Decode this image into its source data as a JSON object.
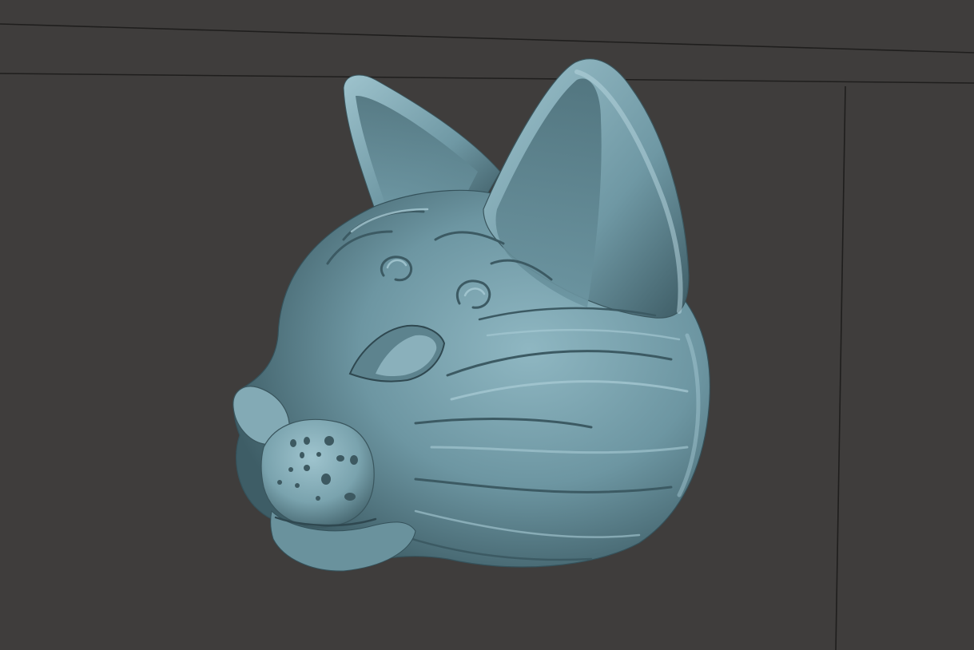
{
  "viewport": {
    "background_color": "#3f3d3c",
    "grid_color": "#1f1e1d",
    "model": {
      "subject": "cat-head-mask",
      "material_color": "#6f98a4",
      "highlight_color": "#a9ccd6",
      "shadow_color": "#35525b"
    }
  }
}
